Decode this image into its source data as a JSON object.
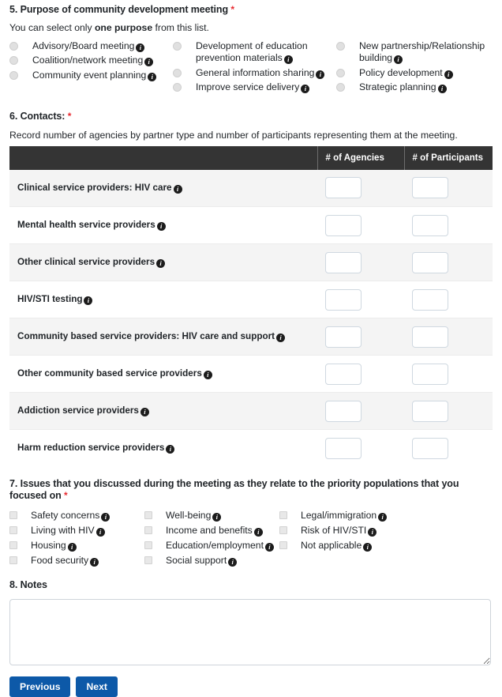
{
  "q5": {
    "number": "5.",
    "heading": "5. Purpose of community development meeting",
    "required_mark": "*",
    "sub_prefix": "You can select only ",
    "sub_bold": "one purpose",
    "sub_suffix": " from this list.",
    "columns": [
      {
        "options": [
          {
            "label": "Advisory/Board meeting",
            "info": "i"
          },
          {
            "label": "Coalition/network meeting",
            "info": "i"
          },
          {
            "label": "Community event planning",
            "info": "i"
          }
        ]
      },
      {
        "options": [
          {
            "label": "Development of education prevention materials",
            "info": "i"
          },
          {
            "label": "General information sharing",
            "info": "i"
          },
          {
            "label": "Improve service delivery",
            "info": "i"
          }
        ]
      },
      {
        "options": [
          {
            "label": "New partnership/Relationship building",
            "info": "i"
          },
          {
            "label": "Policy development",
            "info": "i"
          },
          {
            "label": "Strategic planning",
            "info": "i"
          }
        ]
      }
    ]
  },
  "q6": {
    "heading": "6. Contacts:",
    "required_mark": "*",
    "sub": "Record number of agencies by partner type and number of participants representing them at the meeting.",
    "table": {
      "headers": [
        "",
        "# of Agencies",
        "# of Participants"
      ],
      "rows": [
        {
          "label": "Clinical service providers: HIV care",
          "info": "i",
          "agencies": "",
          "participants": ""
        },
        {
          "label": "Mental health service providers",
          "info": "i",
          "agencies": "",
          "participants": ""
        },
        {
          "label": "Other clinical service providers",
          "info": "i",
          "agencies": "",
          "participants": ""
        },
        {
          "label": "HIV/STI testing",
          "info": "i",
          "agencies": "",
          "participants": ""
        },
        {
          "label": "Community based service providers: HIV care and support",
          "info": "i",
          "agencies": "",
          "participants": ""
        },
        {
          "label": "Other community based service providers",
          "info": "i",
          "agencies": "",
          "participants": ""
        },
        {
          "label": "Addiction service providers",
          "info": "i",
          "agencies": "",
          "participants": ""
        },
        {
          "label": "Harm reduction service providers",
          "info": "i",
          "agencies": "",
          "participants": ""
        }
      ]
    }
  },
  "q7": {
    "heading": "7. Issues that you discussed during the meeting as they relate to the priority populations that you focused on",
    "required_mark": "*",
    "columns": [
      {
        "options": [
          {
            "label": "Safety concerns",
            "info": "i"
          },
          {
            "label": "Living with HIV",
            "info": "i"
          },
          {
            "label": "Housing",
            "info": "i"
          },
          {
            "label": "Food security",
            "info": "i"
          }
        ]
      },
      {
        "options": [
          {
            "label": "Well-being",
            "info": "i"
          },
          {
            "label": "Income and benefits",
            "info": "i"
          },
          {
            "label": "Education/employment",
            "info": "i"
          },
          {
            "label": "Social support",
            "info": "i"
          }
        ]
      },
      {
        "options": [
          {
            "label": "Legal/immigration",
            "info": "i"
          },
          {
            "label": "Risk of HIV/STI",
            "info": "i"
          },
          {
            "label": "Not applicable",
            "info": "i"
          }
        ]
      }
    ]
  },
  "q8": {
    "heading": "8. Notes",
    "value": "",
    "placeholder": ""
  },
  "buttons": {
    "previous": "Previous",
    "next": "Next"
  },
  "colors": {
    "accent_button": "#0d59a8",
    "table_header": "#343434",
    "required_star": "#e8292f",
    "row_stripe": "#f4f4f4"
  }
}
